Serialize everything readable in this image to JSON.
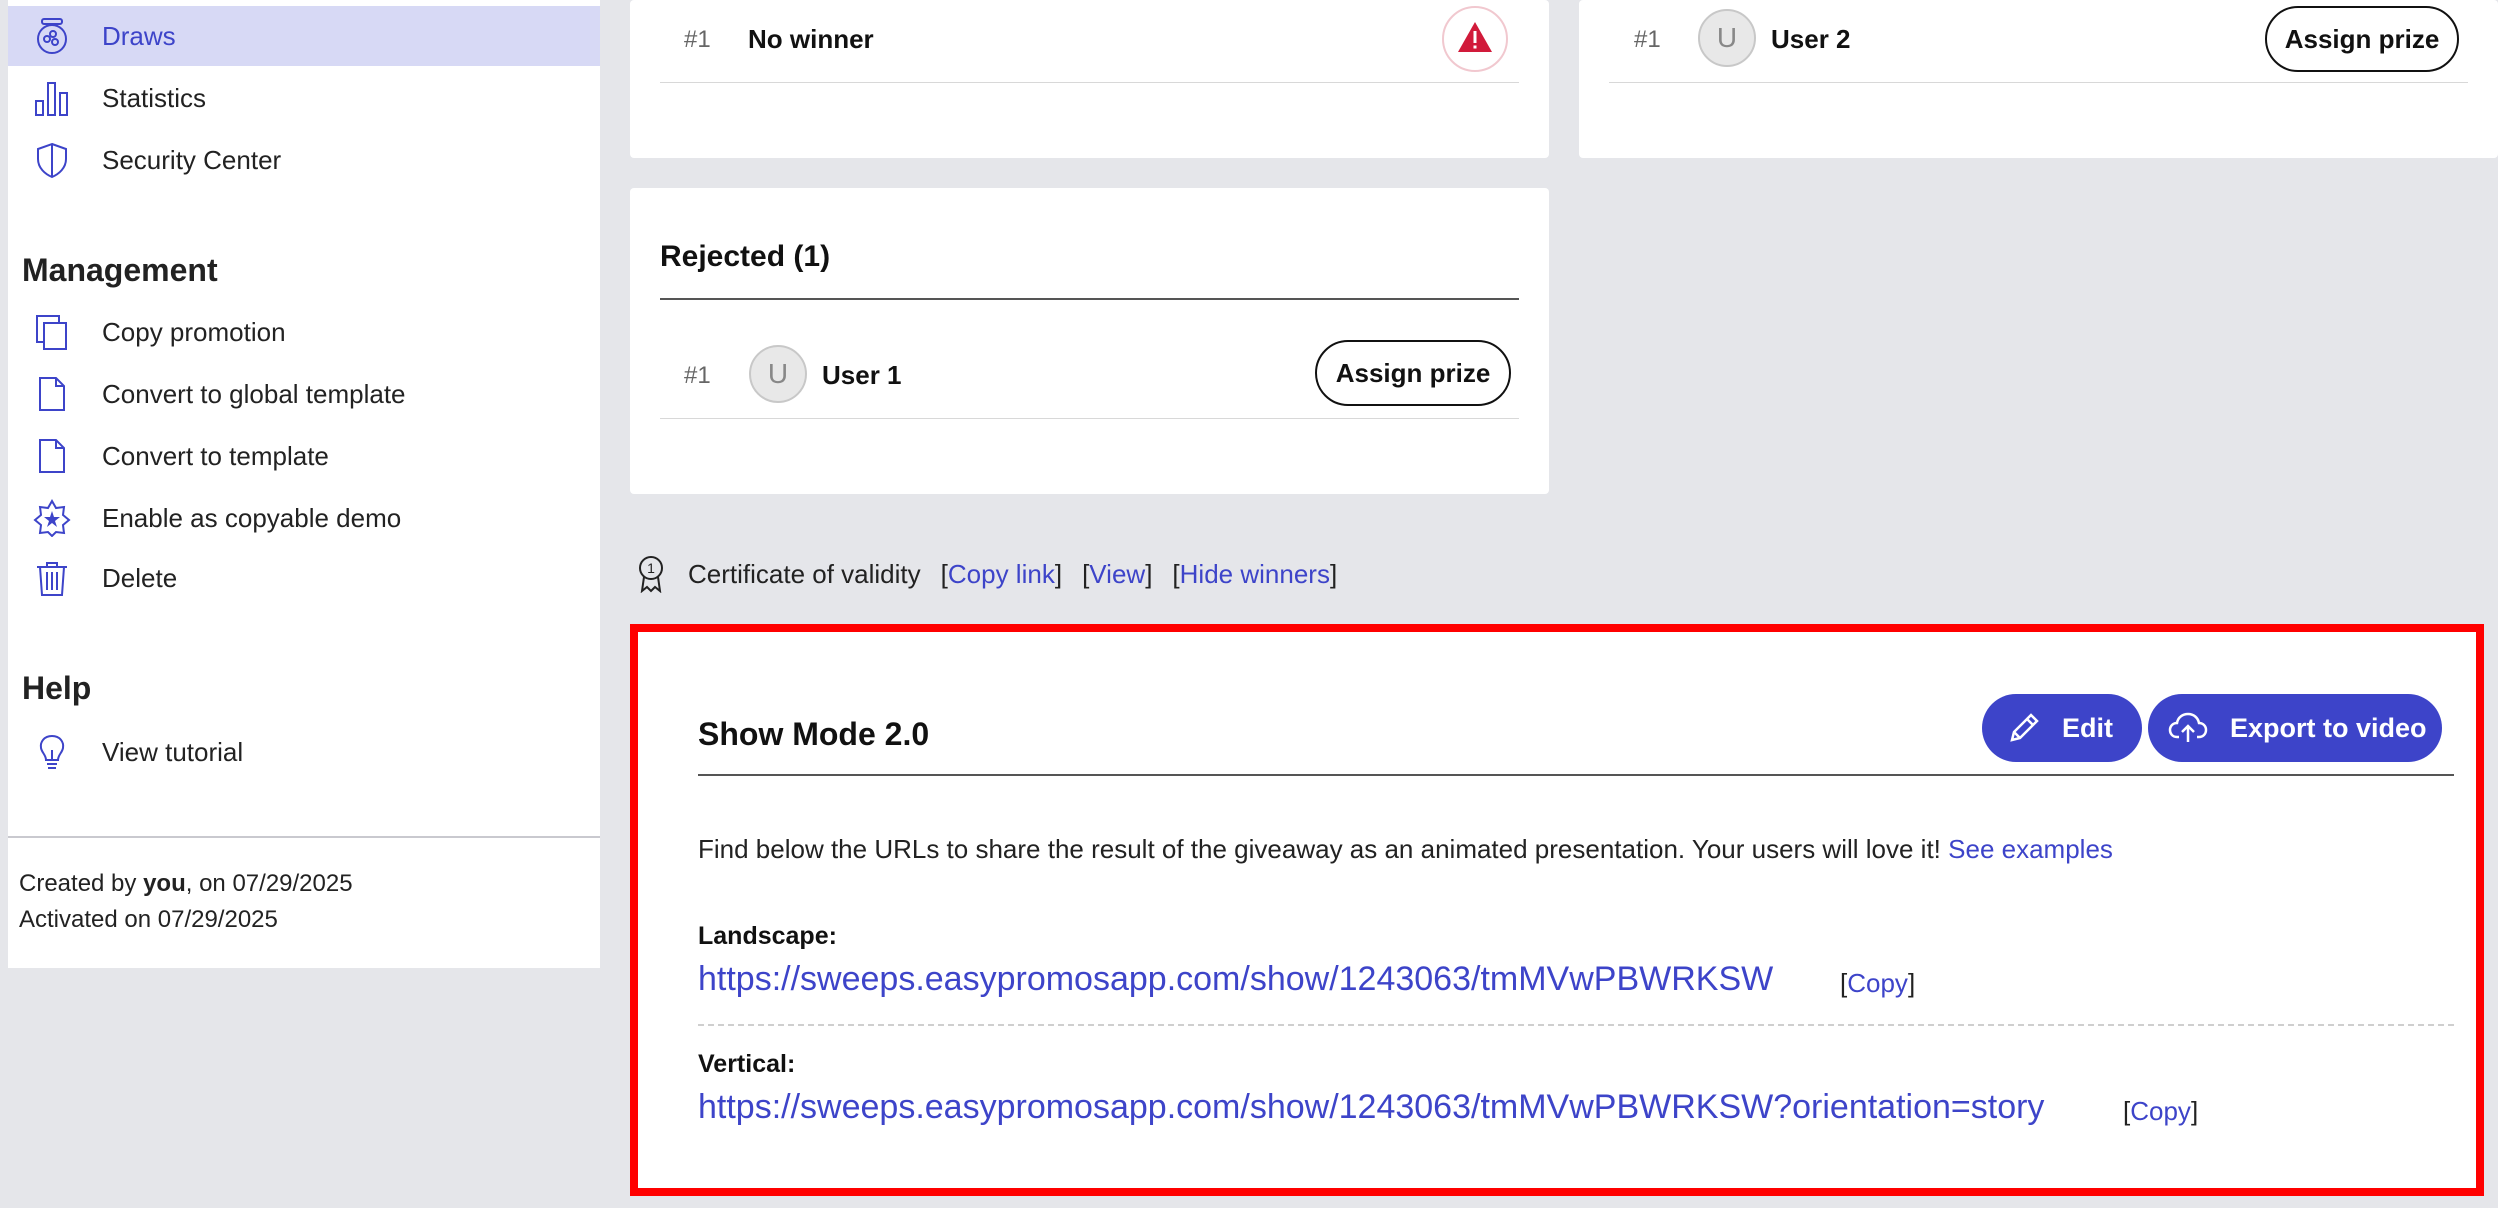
{
  "sidebar": {
    "items": [
      {
        "label": "Draws",
        "icon": "draws-icon"
      },
      {
        "label": "Statistics",
        "icon": "statistics-icon"
      },
      {
        "label": "Security Center",
        "icon": "shield-icon"
      }
    ],
    "management_title": "Management",
    "management_items": [
      {
        "label": "Copy promotion",
        "icon": "copy-icon"
      },
      {
        "label": "Convert to global template",
        "icon": "document-icon"
      },
      {
        "label": "Convert to template",
        "icon": "document-icon"
      },
      {
        "label": "Enable as copyable demo",
        "icon": "star-badge-icon"
      },
      {
        "label": "Delete",
        "icon": "trash-icon"
      }
    ],
    "help_title": "Help",
    "help_items": [
      {
        "label": "View tutorial",
        "icon": "lightbulb-icon"
      }
    ],
    "created_prefix": "Created by ",
    "created_by": "you",
    "created_suffix": ", on 07/29/2025",
    "activated": "Activated on 07/29/2025"
  },
  "winners_card": {
    "rank": "#1",
    "name": "No winner"
  },
  "reserve_card": {
    "rank": "#1",
    "avatar": "U",
    "name": "User 2",
    "button": "Assign prize"
  },
  "rejected_card": {
    "title": "Rejected (1)",
    "rank": "#1",
    "avatar": "U",
    "name": "User 1",
    "button": "Assign prize"
  },
  "certificate": {
    "label": "Certificate of validity",
    "copy_link": "Copy link",
    "view": "View",
    "hide_winners": "Hide winners"
  },
  "show_mode": {
    "title": "Show Mode 2.0",
    "edit_label": "Edit",
    "export_label": "Export to video",
    "description": "Find below the URLs to share the result of the giveaway as an animated presentation. Your users will love it!",
    "see_examples": "See examples",
    "landscape_label": "Landscape:",
    "landscape_url": "https://sweeps.easypromosapp.com/show/1243063/tmMVwPBWRKSW",
    "vertical_label": "Vertical:",
    "vertical_url": "https://sweeps.easypromosapp.com/show/1243063/tmMVwPBWRKSW?orientation=story",
    "copy_label": "Copy"
  },
  "colors": {
    "accent": "#3d44c9",
    "active_bg": "#d7d9f5",
    "highlight_border": "#ff0000",
    "alert": "#d11a3a"
  }
}
